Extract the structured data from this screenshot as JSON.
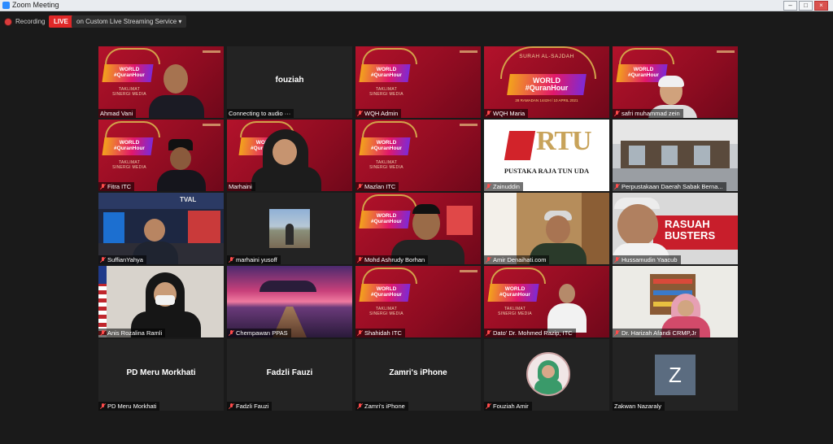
{
  "window": {
    "title": "Zoom Meeting"
  },
  "topbar": {
    "recording_label": "Recording",
    "live_label": "LIVE",
    "stream_label": "on Custom Live Streaming Service",
    "stream_caret": "▾"
  },
  "poster_text": {
    "wqh_line1": "WORLD",
    "wqh_line2": "#QuranHour",
    "taklimat": "TAKLIMAT",
    "sinergi": "SINERGI MEDIA",
    "surah": "SURAH AL-SAJDAH",
    "wqh_date": "28 RAMADAN 1442H / 10 APRIL 2021"
  },
  "logo_text": {
    "rtu": "RTU",
    "pustaka": "PUSTAKA RAJA TUN UDA"
  },
  "banner_text": {
    "rasuah": "RASUAH",
    "busters": "BUSTERS"
  },
  "studio_text": {
    "tv": "TVAL"
  },
  "avatar_letter": "Z",
  "participants": [
    {
      "name": "Ahmad Vani"
    },
    {
      "name": "Connecting to audio ···",
      "display": "fouziah"
    },
    {
      "name": "WQH Admin"
    },
    {
      "name": "WQH Maria"
    },
    {
      "name": "safri muhammad zein"
    },
    {
      "name": "Fitra ITC"
    },
    {
      "name": "Marhaini"
    },
    {
      "name": "Mazlan ITC"
    },
    {
      "name": "Zainuddin"
    },
    {
      "name": "Perpustakaan Daerah Sabak Berna..."
    },
    {
      "name": "SuffianYahya"
    },
    {
      "name": "marhaini yusoff"
    },
    {
      "name": "Mohd Ashrudy Borhan"
    },
    {
      "name": "Amir Denaihati.com"
    },
    {
      "name": "Hussamudin Yaacub"
    },
    {
      "name": "Anis Rozalina Ramli"
    },
    {
      "name": "Chempawan PPAS"
    },
    {
      "name": "Shahidah ITC"
    },
    {
      "name": "Dato' Dr. Mohmed Razip, ITC"
    },
    {
      "name": "Dr. Harizah Afandi CRMP,Jr"
    },
    {
      "name": "PD Meru Morkhati",
      "display": "PD Meru Morkhati"
    },
    {
      "name": "Fadzli Fauzi",
      "display": "Fadzli Fauzi"
    },
    {
      "name": "Zamri's iPhone",
      "display": "Zamri's iPhone"
    },
    {
      "name": "Fouziah Amir"
    },
    {
      "name": "Zakwan Nazaraly"
    }
  ],
  "colors": {
    "active_speaker": "#f5d033",
    "live": "#e02828",
    "mute": "#ff4b4b",
    "poster": "#b3122b"
  }
}
